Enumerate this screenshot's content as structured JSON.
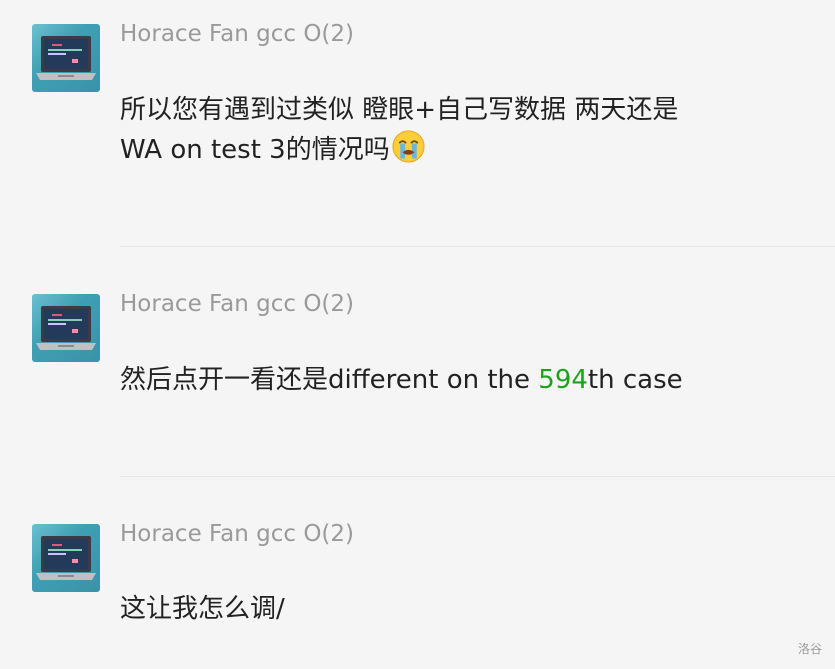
{
  "messages": [
    {
      "author": "Horace Fan gcc O(2)",
      "line1": "所以您有遇到过类似  瞪眼+自己写数据 两天还是",
      "line2": "WA on test 3的情况吗",
      "emoji": "crying-face-icon"
    },
    {
      "author": "Horace Fan gcc O(2)",
      "text_before": "然后点开一看还是different on the ",
      "highlight": "594",
      "text_after": "th case",
      "highlight_color": "#1aa41a"
    },
    {
      "author": "Horace Fan gcc O(2)",
      "text": "这让我怎么调/"
    }
  ],
  "watermark": "洛谷",
  "colors": {
    "background": "#f5f5f5",
    "author": "#9a9a9a",
    "text": "#222222",
    "highlight": "#1aa41a",
    "divider": "#e6e6e6"
  }
}
